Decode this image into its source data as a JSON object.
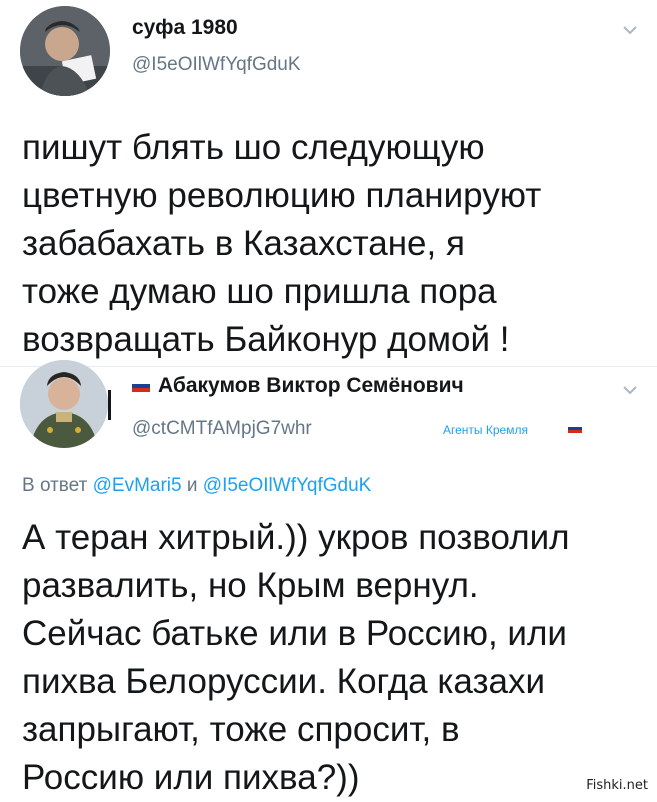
{
  "tweet1": {
    "name": "суфа 1980",
    "handle": "@I5eOIlWfYqfGduK",
    "text": "пишут блять шо следующую\nцветную революцию планируют\nзабабахать в Казахстане, я\nтоже думаю шо пришла пора\nвозвращать Байконур домой !"
  },
  "tweet2": {
    "name": "Абакумов Виктор Семёнович",
    "handle": "@ctCMTfAMpjG7whr",
    "bio": "Агенты Кремля",
    "reply_prefix": "В ответ",
    "reply_user1": "@EvMari5",
    "reply_and": "и",
    "reply_user2": "@I5eOIlWfYqfGduK",
    "text": "А теран хитрый.)) укров позволил\nразвалить, но Крым вернул.\nСейчас батьке или в Россию, или\nпихва Белоруссии. Когда казахи\nзапрыгают, тоже спросит, в\nРоссию или пихва?))"
  },
  "watermark": "Fishki.net",
  "colors": {
    "text": "#14171a",
    "secondary": "#657786",
    "link": "#1da1f2",
    "flag_white": "#ffffff",
    "flag_blue": "#1c3f94",
    "flag_red": "#d52b1e"
  }
}
